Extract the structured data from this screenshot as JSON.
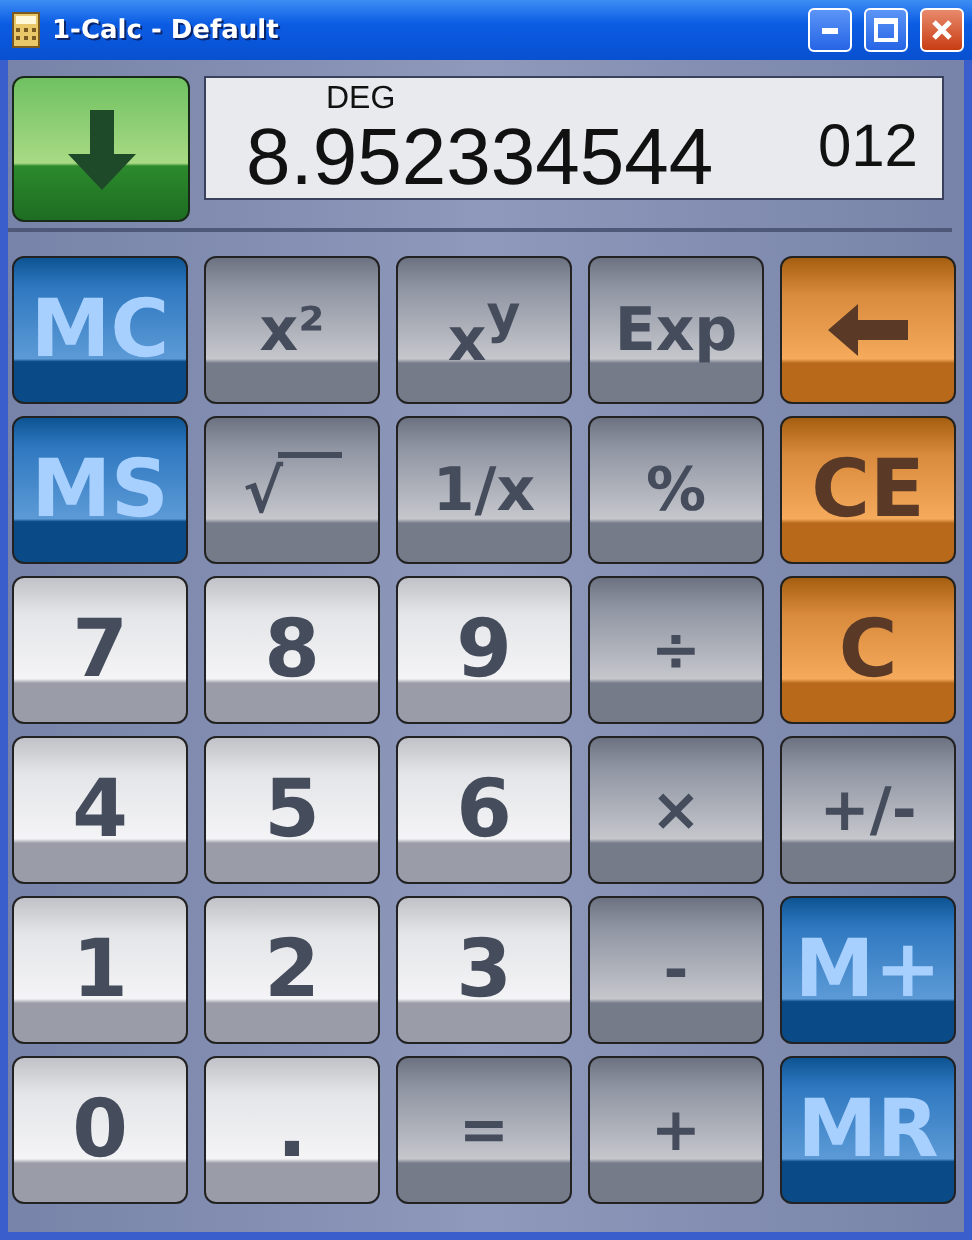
{
  "window": {
    "title": "1-Calc - Default"
  },
  "display": {
    "mode": "DEG",
    "value": "8.952334544",
    "exponent": "012"
  },
  "keys": [
    {
      "kind": "memory",
      "label": "MC"
    },
    {
      "kind": "function",
      "label": "x²"
    },
    {
      "kind": "function",
      "label": "x$^{y}$"
    },
    {
      "kind": "function",
      "label": "Exp"
    },
    {
      "kind": "backspace"
    },
    {
      "kind": "memory",
      "label": "MS"
    },
    {
      "kind": "root",
      "label": "√"
    },
    {
      "kind": "function",
      "label": "1/x"
    },
    {
      "kind": "function",
      "label": "%"
    },
    {
      "kind": "clear",
      "label": "CE"
    },
    {
      "kind": "digit",
      "label": "7"
    },
    {
      "kind": "digit",
      "label": "8"
    },
    {
      "kind": "digit",
      "label": "9"
    },
    {
      "kind": "function",
      "label": "÷"
    },
    {
      "kind": "clear",
      "label": "C"
    },
    {
      "kind": "digit",
      "label": "4"
    },
    {
      "kind": "digit",
      "label": "5"
    },
    {
      "kind": "digit",
      "label": "6"
    },
    {
      "kind": "function",
      "label": "×"
    },
    {
      "kind": "function",
      "label": "+/-"
    },
    {
      "kind": "digit",
      "label": "1"
    },
    {
      "kind": "digit",
      "label": "2"
    },
    {
      "kind": "digit",
      "label": "3"
    },
    {
      "kind": "function",
      "label": "-"
    },
    {
      "kind": "memory",
      "label": "M+"
    },
    {
      "kind": "digit",
      "label": "0"
    },
    {
      "kind": "digit",
      "label": "."
    },
    {
      "kind": "function",
      "label": "="
    },
    {
      "kind": "function",
      "label": "+"
    },
    {
      "kind": "memory",
      "label": "MR"
    }
  ]
}
